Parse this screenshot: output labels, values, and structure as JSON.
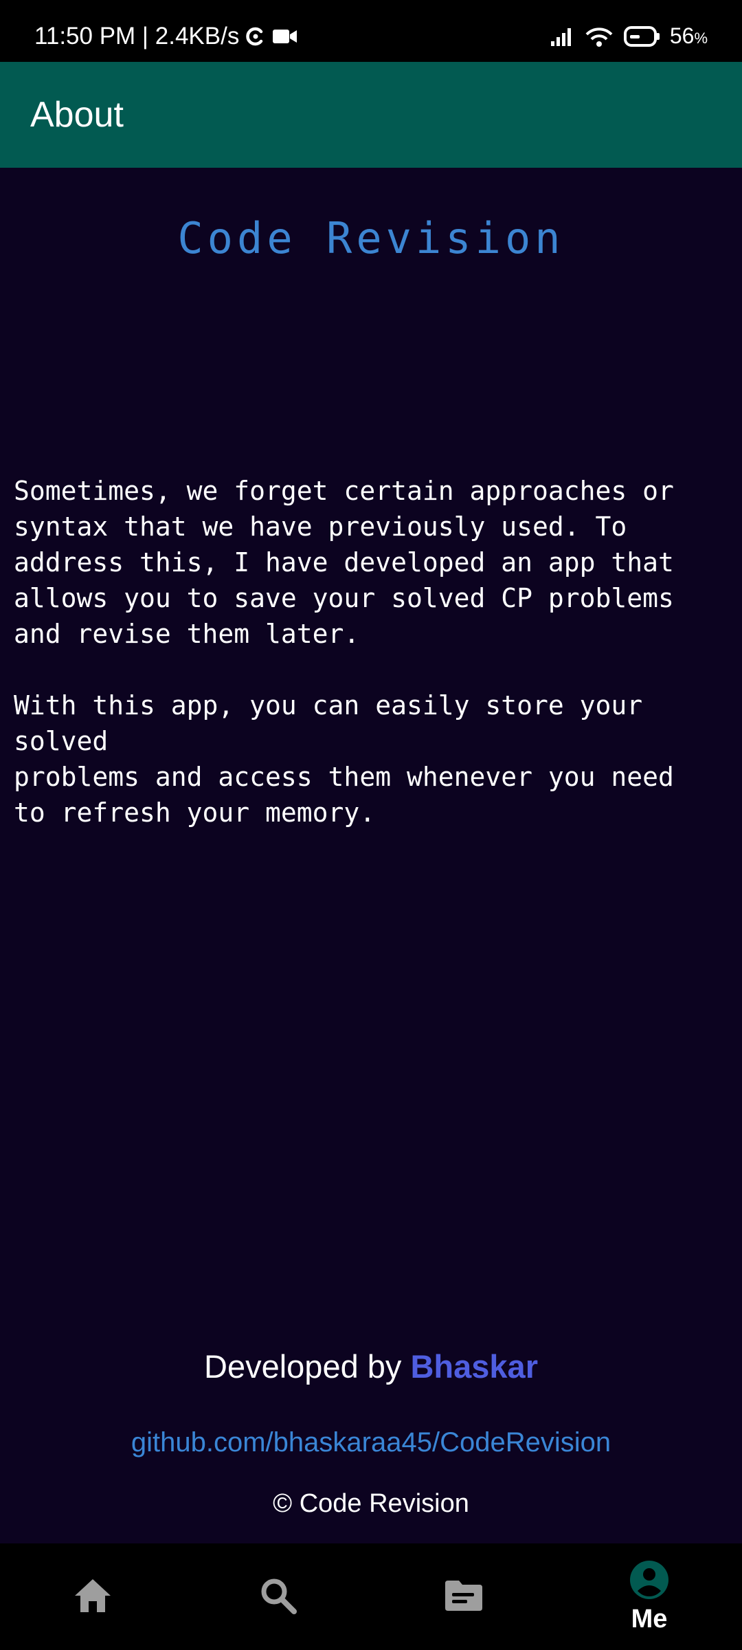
{
  "status_bar": {
    "time_speed": "11:50 PM | 2.4KB/s",
    "battery": "56",
    "battery_unit": "%",
    "icons": [
      "sync-icon",
      "video-camera-icon",
      "signal-icon",
      "wifi-icon",
      "battery-icon"
    ]
  },
  "app_bar": {
    "title": "About"
  },
  "content": {
    "heading": "Code Revision",
    "paragraph_1": "Sometimes, we forget certain approaches or\nsyntax that we have previously used. To\naddress this, I have developed an app that\nallows you to save your solved CP problems\nand revise them later.",
    "paragraph_2": "With this app, you can easily store your solved\nproblems and access them whenever you need\nto refresh your memory.",
    "developed_by_prefix": "Developed by ",
    "developer_name": "Bhaskar",
    "github_link": "github.com/bhaskaraa45/CodeRevision",
    "copyright": "© Code Revision"
  },
  "bottom_nav": {
    "items": [
      {
        "icon": "home-icon",
        "label": ""
      },
      {
        "icon": "search-icon",
        "label": ""
      },
      {
        "icon": "notes-icon",
        "label": ""
      },
      {
        "icon": "account-icon",
        "label": "Me",
        "selected": true
      }
    ]
  },
  "colors": {
    "background": "#0c0320",
    "app_bar": "#025a51",
    "heading": "#3c85d2",
    "developer_name": "#4f5ee0",
    "link": "#3a86d6",
    "nav_icon": "#9e9e9e",
    "nav_selected_icon": "#025a51"
  }
}
